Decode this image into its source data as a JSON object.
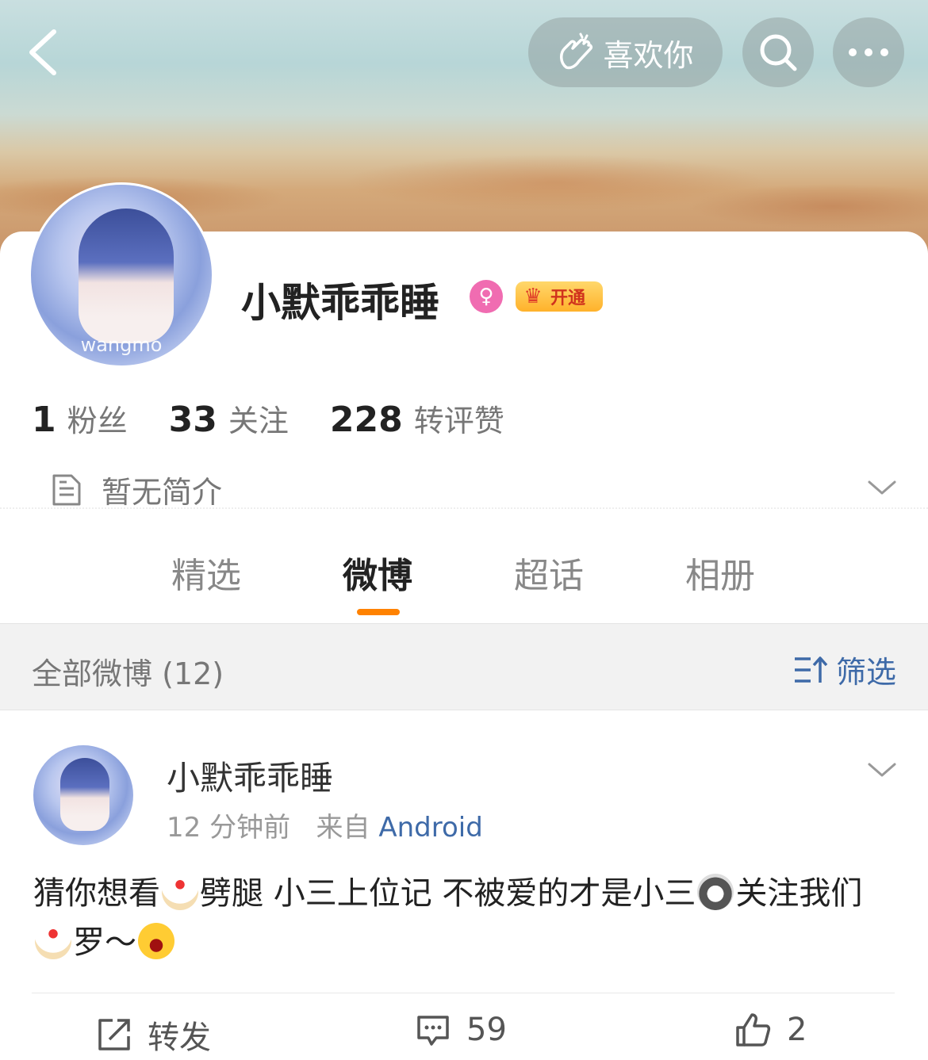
{
  "header": {
    "like_label": "喜欢你"
  },
  "profile": {
    "name": "小默乖乖睡",
    "gender_symbol": "♀",
    "vip_label": "开通",
    "avatar_watermark": "wangmo",
    "stats": [
      {
        "num": "1",
        "label": "粉丝"
      },
      {
        "num": "33",
        "label": "关注"
      },
      {
        "num": "228",
        "label": "转评赞"
      }
    ],
    "bio": "暂无简介"
  },
  "tabs": [
    "精选",
    "微博",
    "超话",
    "相册"
  ],
  "active_tab": "微博",
  "filterbar": {
    "all_label": "全部微博 (12)",
    "filter_label": "筛选"
  },
  "post": {
    "author": "小默乖乖睡",
    "time": "12 分钟前",
    "from_prefix": "来自",
    "source": "Android",
    "text_parts": [
      "猜你想看",
      "劈腿 小三上位记  不被爱的才是小三",
      "关注我们",
      "罗～"
    ],
    "repost_label": "转发",
    "comment_count": "59",
    "like_count": "2"
  },
  "colors": {
    "accent_orange": "#ff8200",
    "link_blue": "#3e6aa8",
    "female_pink": "#f06cb1"
  }
}
